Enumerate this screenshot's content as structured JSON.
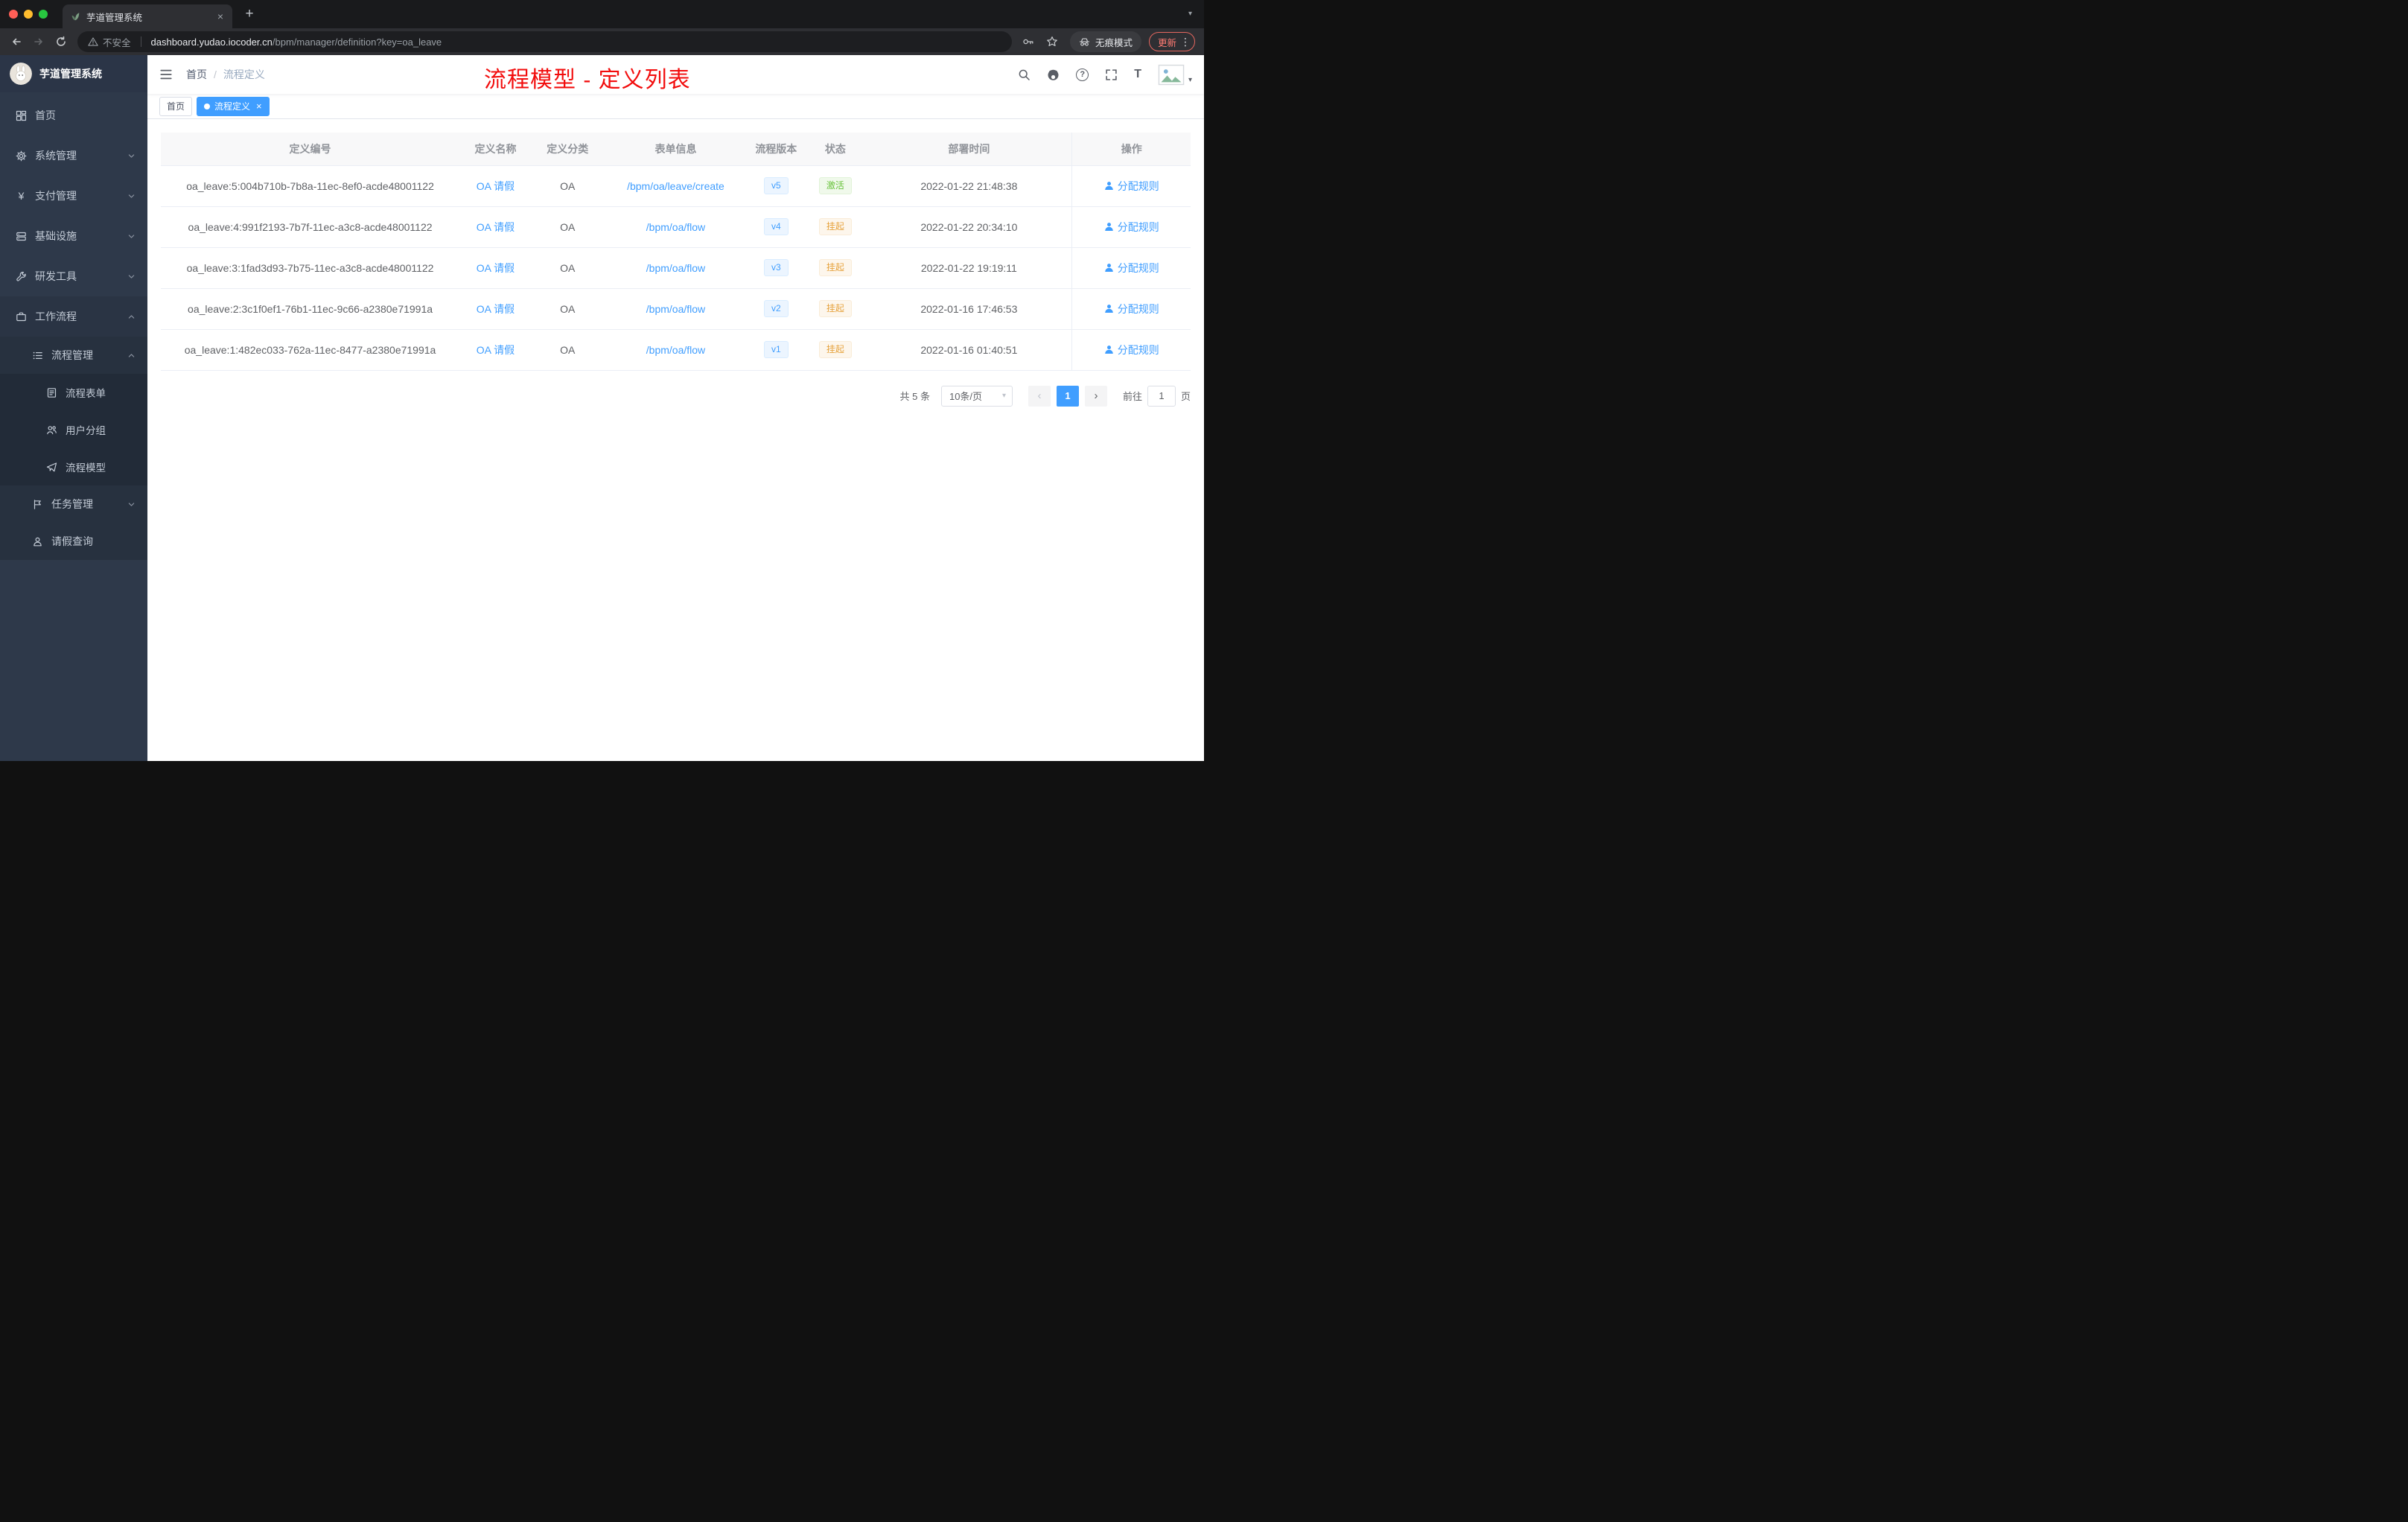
{
  "browser": {
    "tab_title": "芋道管理系统",
    "security_label": "不安全",
    "url_host": "dashboard.yudao.iocoder.cn",
    "url_path": "/bpm/manager/definition?key=oa_leave",
    "profile_label": "无痕模式",
    "update_label": "更新"
  },
  "glyphs": {
    "close": "×",
    "plus": "+",
    "menu_dots": "⋮",
    "caret_down": "▾",
    "prev": "‹",
    "next": "›",
    "yen": "¥",
    "question": "?",
    "font_size": "T"
  },
  "sidebar": {
    "logo_title": "芋道管理系统",
    "items": [
      {
        "label": "首页"
      },
      {
        "label": "系统管理"
      },
      {
        "label": "支付管理"
      },
      {
        "label": "基础设施"
      },
      {
        "label": "研发工具"
      },
      {
        "label": "工作流程"
      },
      {
        "label": "流程管理"
      },
      {
        "label": "流程表单"
      },
      {
        "label": "用户分组"
      },
      {
        "label": "流程模型"
      },
      {
        "label": "任务管理"
      },
      {
        "label": "请假查询"
      }
    ]
  },
  "navbar": {
    "breadcrumb": {
      "home": "首页",
      "sep": "/",
      "current": "流程定义"
    }
  },
  "annotation": "流程模型 - 定义列表",
  "tags": {
    "home": "首页",
    "current": "流程定义"
  },
  "table": {
    "columns": [
      "定义编号",
      "定义名称",
      "定义分类",
      "表单信息",
      "流程版本",
      "状态",
      "部署时间",
      "操作"
    ],
    "action_label": "分配规则",
    "rows": [
      {
        "id": "oa_leave:5:004b710b-7b8a-11ec-8ef0-acde48001122",
        "name": "OA 请假",
        "category": "OA",
        "form": "/bpm/oa/leave/create",
        "version": "v5",
        "status": "激活",
        "status_type": "success",
        "time": "2022-01-22 21:48:38"
      },
      {
        "id": "oa_leave:4:991f2193-7b7f-11ec-a3c8-acde48001122",
        "name": "OA 请假",
        "category": "OA",
        "form": "/bpm/oa/flow",
        "version": "v4",
        "status": "挂起",
        "status_type": "warning",
        "time": "2022-01-22 20:34:10"
      },
      {
        "id": "oa_leave:3:1fad3d93-7b75-11ec-a3c8-acde48001122",
        "name": "OA 请假",
        "category": "OA",
        "form": "/bpm/oa/flow",
        "version": "v3",
        "status": "挂起",
        "status_type": "warning",
        "time": "2022-01-22 19:19:11"
      },
      {
        "id": "oa_leave:2:3c1f0ef1-76b1-11ec-9c66-a2380e71991a",
        "name": "OA 请假",
        "category": "OA",
        "form": "/bpm/oa/flow",
        "version": "v2",
        "status": "挂起",
        "status_type": "warning",
        "time": "2022-01-16 17:46:53"
      },
      {
        "id": "oa_leave:1:482ec033-762a-11ec-8477-a2380e71991a",
        "name": "OA 请假",
        "category": "OA",
        "form": "/bpm/oa/flow",
        "version": "v1",
        "status": "挂起",
        "status_type": "warning",
        "time": "2022-01-16 01:40:51"
      }
    ]
  },
  "pagination": {
    "total": "共 5 条",
    "page_size": "10条/页",
    "page": "1",
    "goto_prefix": "前往",
    "goto_value": "1",
    "goto_suffix": "页"
  },
  "colors": {
    "accent": "#409eff",
    "success": "#67c23a",
    "warning": "#e6a23c",
    "annotation": "#f20d0d"
  }
}
